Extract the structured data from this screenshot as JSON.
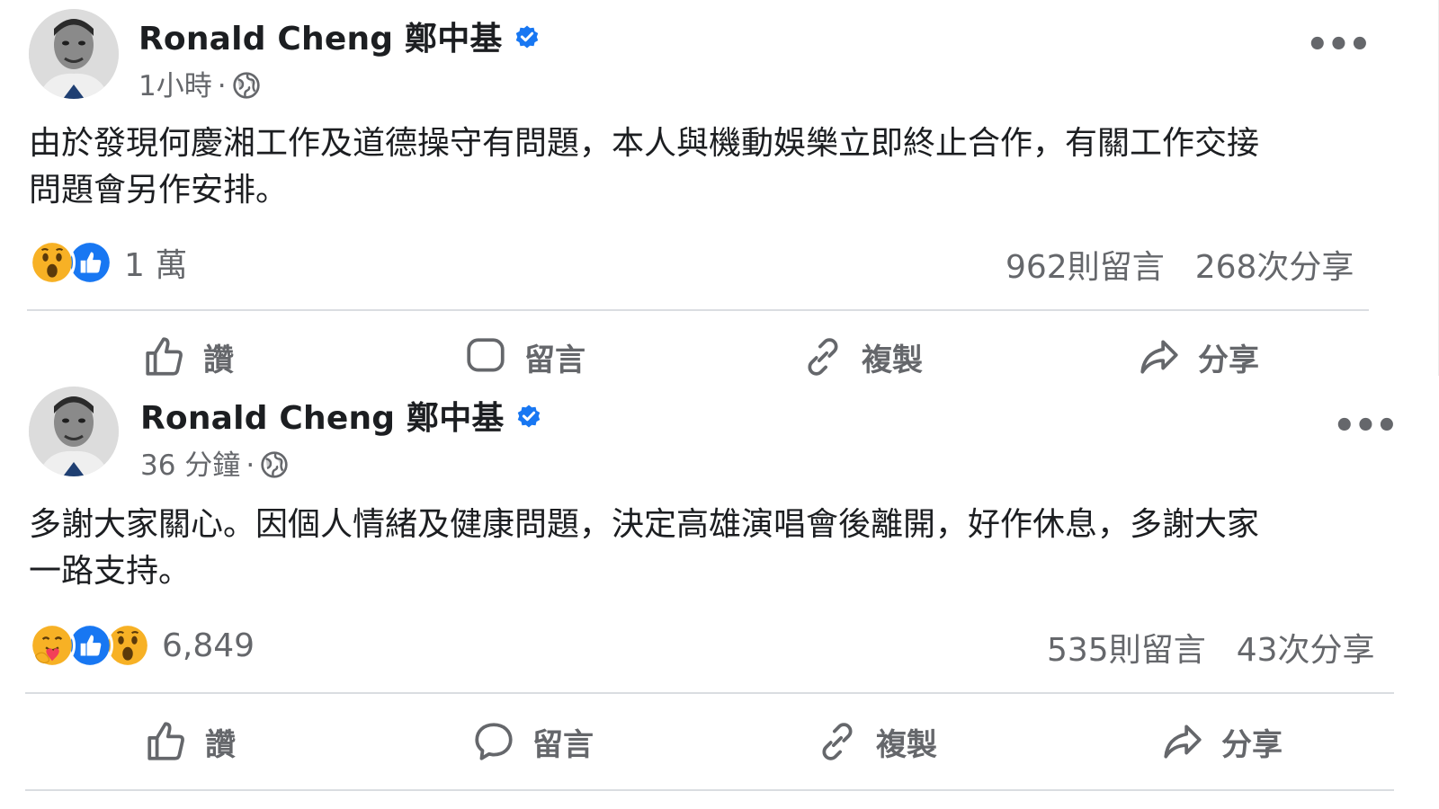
{
  "posts": [
    {
      "author": "Ronald Cheng 鄭中基",
      "time": "1小時",
      "separator": "·",
      "text_line1": "由於發現何慶湘工作及道德操守有問題，本人與機動娛樂立即終止合作，有關工作交接",
      "text_line2": "問題會另作安排。",
      "reaction_count": "1 萬",
      "comments": "962則留言",
      "shares": "268次分享",
      "reactions": [
        "wow-icon",
        "like-icon"
      ],
      "actions": {
        "like": "讚",
        "comment": "留言",
        "copy": "複製",
        "share": "分享"
      }
    },
    {
      "author": "Ronald Cheng 鄭中基",
      "time": "36 分鐘",
      "separator": "·",
      "text_line1": "多謝大家關心。因個人情緒及健康問題，決定高雄演唱會後離開，好作休息，多謝大家",
      "text_line2": "一路支持。",
      "reaction_count": "6,849",
      "comments": "535則留言",
      "shares": "43次分享",
      "reactions": [
        "care-icon",
        "like-icon",
        "wow-icon"
      ],
      "actions": {
        "like": "讚",
        "comment": "留言",
        "copy": "複製",
        "share": "分享"
      }
    }
  ],
  "colors": {
    "verified_blue": "#1877f2",
    "like_blue": "#1877f2",
    "wow_yellow": "#f7b125",
    "secondary_text": "#65676b",
    "divider": "#dadde1"
  }
}
